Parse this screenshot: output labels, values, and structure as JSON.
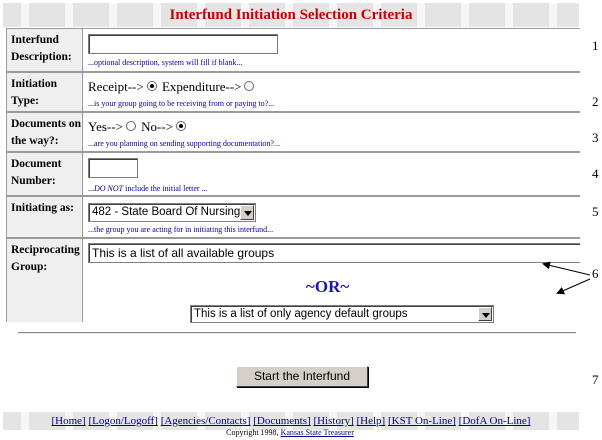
{
  "page": {
    "title": "Interfund Initiation Selection Criteria"
  },
  "form": {
    "description": {
      "label": "Interfund Description:",
      "value": "",
      "hint": "...optional description, system will fill if blank..."
    },
    "initiation_type": {
      "label": "Initiation Type:",
      "option_receipt": "Receipt-->",
      "option_expenditure": "Expenditure-->",
      "selected": "Receipt",
      "hint": "...is your group going to be receiving from or paying to?..."
    },
    "documents": {
      "label": "Documents on the way?:",
      "option_yes": "Yes-->",
      "option_no": "No-->",
      "selected": "No",
      "hint": "...are you planning on sending supporting documentation?..."
    },
    "document_number": {
      "label": "Document Number:",
      "value": "",
      "hint_prefix": "...",
      "hint_em": "DO NOT",
      "hint_suffix": " include the initial letter ..."
    },
    "initiating_as": {
      "label": "Initiating as:",
      "selected": "482 - State Board Of Nursing",
      "hint": "...the group you are acting for in initiating this interfund..."
    },
    "reciprocating": {
      "label": "Reciprocating Group:",
      "all_groups_text": "This is a list of all available groups",
      "or_text": "~OR~",
      "agency_groups_text": "This is a list of only agency default groups"
    }
  },
  "step_numbers": [
    "1",
    "2",
    "3",
    "4",
    "5",
    "6",
    "7"
  ],
  "start_button": "Start the Interfund",
  "footer": {
    "links": [
      "[Home]",
      "[Logon/Logoff]",
      "[Agencies/Contacts]",
      "[Documents]",
      "[History]",
      "[Help]",
      "[KST On-Line]",
      "[DofA On-Line]"
    ],
    "copyright_prefix": "Copyright 1998, ",
    "copyright_link": "Kansas State Treasurer"
  },
  "colors": {
    "title": "#cc0000",
    "hint": "#00009a",
    "or": "#1a1aa8",
    "label_bg": "#efefef"
  }
}
